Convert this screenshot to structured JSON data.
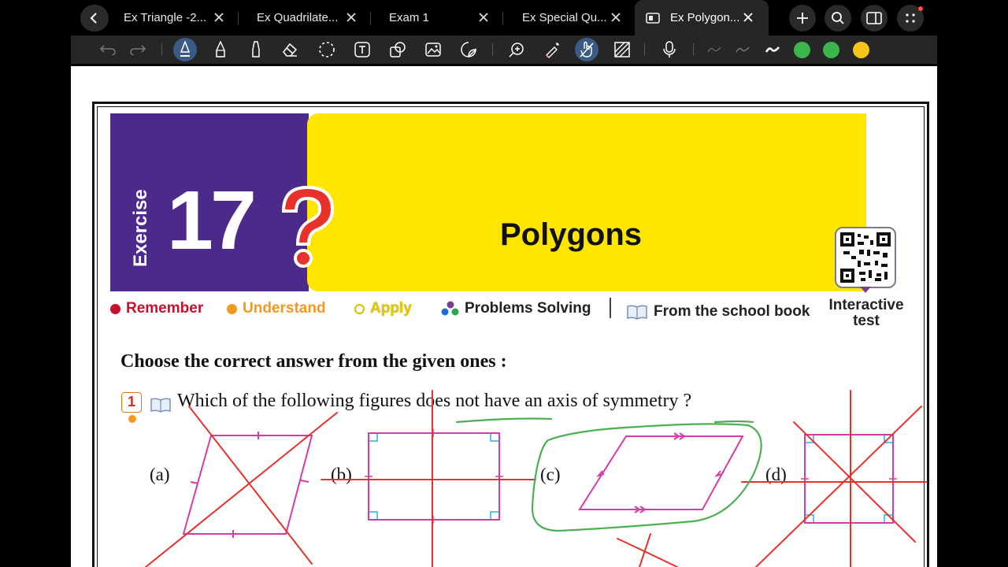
{
  "tabs": [
    {
      "title": "Ex Triangle -2...",
      "active": false
    },
    {
      "title": "Ex Quadrilate...",
      "active": false
    },
    {
      "title": "Exam 1",
      "active": false
    },
    {
      "title": "Ex Special Qu...",
      "active": false
    },
    {
      "title": "Ex Polygon...",
      "active": true
    }
  ],
  "toolbar": {
    "colors": [
      "#3cb54a",
      "#3cb54a",
      "#f5c518"
    ]
  },
  "document": {
    "banner": {
      "exercise_word": "Exercise",
      "exercise_number": "17",
      "title": "Polygons"
    },
    "legend": {
      "remember": "Remember",
      "understand": "Understand",
      "apply": "Apply",
      "problems": "Problems Solving",
      "school_book": "From the school book"
    },
    "interactive_test": "Interactive test",
    "heading": "Choose the correct answer from the given ones :",
    "question": {
      "number": "1",
      "text": "Which of the following figures does not have an axis of symmetry ?"
    },
    "options": [
      "(a)",
      "(b)",
      "(c)",
      "(d)"
    ]
  },
  "colors": {
    "banner_purple": "#4b2a8c",
    "banner_yellow": "#ffe600",
    "figure_magenta": "#d63ca8",
    "annotation_red": "#e8312a",
    "annotation_green": "#4caf50"
  }
}
